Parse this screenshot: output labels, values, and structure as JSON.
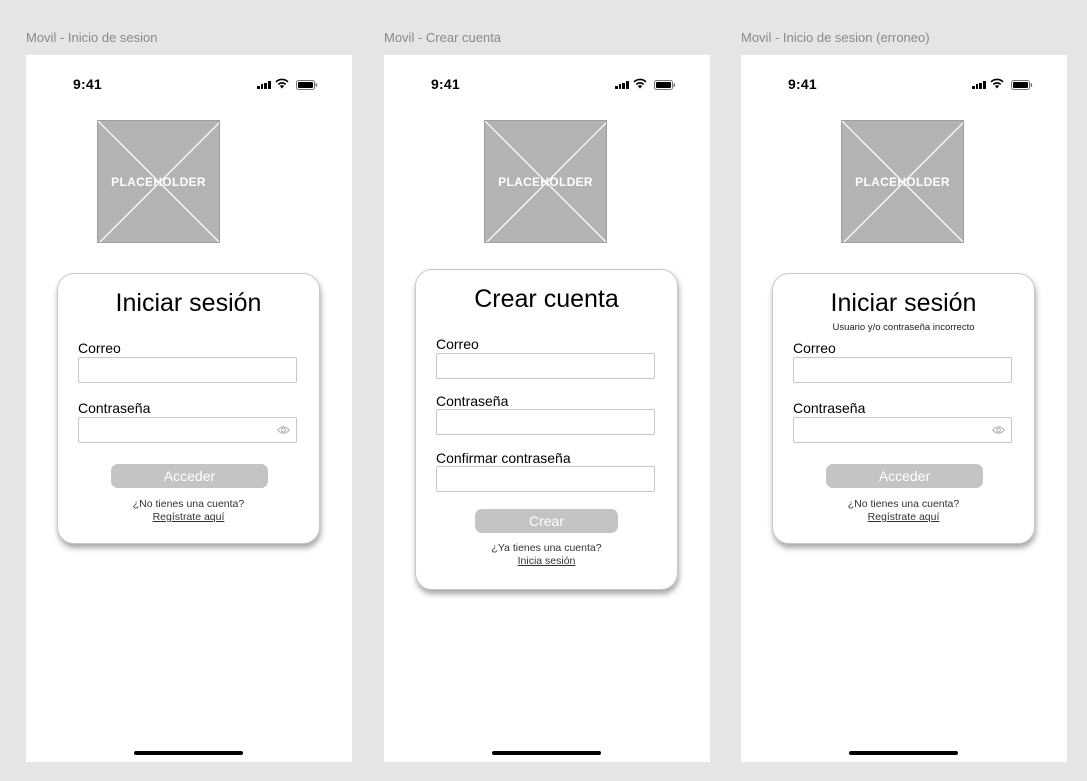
{
  "frames": [
    {
      "label": "Movil - Inicio de sesion",
      "status": {
        "time": "9:41"
      },
      "placeholder": "PLACEHOLDER",
      "card": {
        "title": "Iniciar sesión",
        "email_label": "Correo",
        "email_value": "",
        "password_label": "Contraseña",
        "password_value": "",
        "button": "Acceder",
        "prompt": "¿No tienes una cuenta?",
        "link": "Regístrate aquí"
      }
    },
    {
      "label": "Movil - Crear cuenta",
      "status": {
        "time": "9:41"
      },
      "placeholder": "PLACEHOLDER",
      "card": {
        "title": "Crear cuenta",
        "email_label": "Correo",
        "email_value": "",
        "password_label": "Contraseña",
        "password_value": "",
        "confirm_label": "Confirmar contraseña",
        "confirm_value": "",
        "button": "Crear",
        "prompt": "¿Ya tienes una cuenta?",
        "link": "Inicia sesión"
      }
    },
    {
      "label": "Movil - Inicio de sesion (erroneo)",
      "status": {
        "time": "9:41"
      },
      "placeholder": "PLACEHOLDER",
      "card": {
        "title": "Iniciar sesión",
        "error": "Usuario y/o contraseña incorrecto",
        "email_label": "Correo",
        "email_value": "",
        "password_label": "Contraseña",
        "password_value": "",
        "button": "Acceder",
        "prompt": "¿No tienes una cuenta?",
        "link": "Regístrate aquí"
      }
    }
  ],
  "icons": {
    "signal": "cellular-signal-icon",
    "wifi": "wifi-icon",
    "battery": "battery-icon",
    "eye": "eye-icon",
    "image": "image-placeholder-icon"
  },
  "colors": {
    "canvas": "#e5e5e5",
    "placeholder": "#b3b3b3",
    "button": "#c4c4c4",
    "frame_label": "#8a8a8a"
  }
}
